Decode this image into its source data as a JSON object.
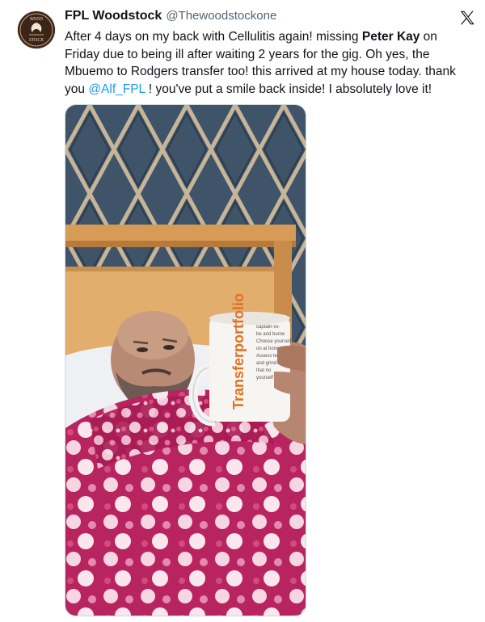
{
  "tweet": {
    "author_name": "FPL Woodstock",
    "author_handle": "@Thewoodstockone",
    "avatar": {
      "text_top": "WOOD",
      "text_bottom": "STOCK"
    },
    "platform_icon": "x-logo-icon",
    "body": {
      "part1": "After 4 days on my back with Cellulitis again! missing ",
      "bold1": "Peter Kay",
      "part2": " on Friday due to being ill after waiting 2 years for the gig. Oh yes, the Mbuemo to Rodgers transfer too! this arrived at my house today. thank you ",
      "mention": "@Alf_FPL",
      "part3": " ! you've put a smile back inside! I absolutely love it!"
    },
    "media": {
      "mug_text": "Transferportfolio",
      "mug_small_lines": [
        "captain-vs-",
        "be and burne",
        "Choose yourself",
        "on at home",
        "Assess team",
        "and grind",
        "that no",
        "yourself"
      ]
    }
  },
  "colors": {
    "accent": "#1d9bf0",
    "text": "#0f1419",
    "secondary": "#536471",
    "blanket": "#b01f5c",
    "mug_orange": "#e3701f"
  }
}
